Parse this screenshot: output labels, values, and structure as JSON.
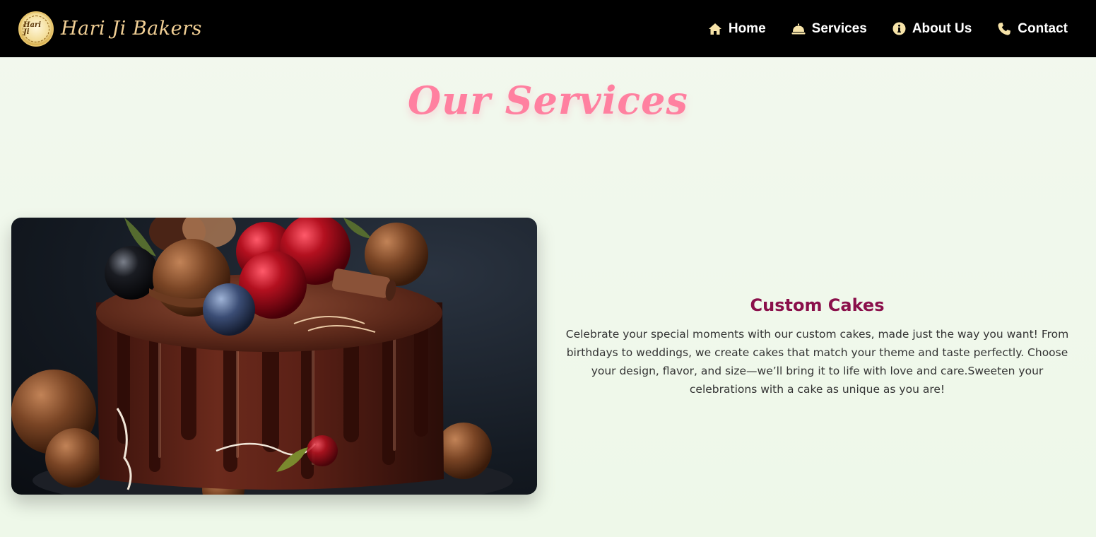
{
  "brand": {
    "name": "Hari Ji Bakers",
    "logo_text": "Hari Ji"
  },
  "nav": {
    "items": [
      {
        "label": "Home",
        "icon": "home-icon"
      },
      {
        "label": "Services",
        "icon": "cloche-icon"
      },
      {
        "label": "About Us",
        "icon": "info-icon"
      },
      {
        "label": "Contact",
        "icon": "phone-icon"
      }
    ]
  },
  "page": {
    "title": "Our Services"
  },
  "service": {
    "title": "Custom Cakes",
    "description": "Celebrate your special moments with our custom cakes, made just the way you want! From birthdays to weddings, we create cakes that match your theme and taste perfectly. Choose your design, flavor, and size—we’ll bring it to life with love and care.Sweeten your celebrations with a cake as unique as you are!",
    "image": "chocolate-drip-cake-image"
  },
  "colors": {
    "navbar": "#000000",
    "nav_text": "#ffffff",
    "nav_icon": "#f6e3a8",
    "brand": "#f1cf95",
    "title": "#ff80a0",
    "service_title": "#8a0f4a",
    "background": "#f0f8eb"
  }
}
